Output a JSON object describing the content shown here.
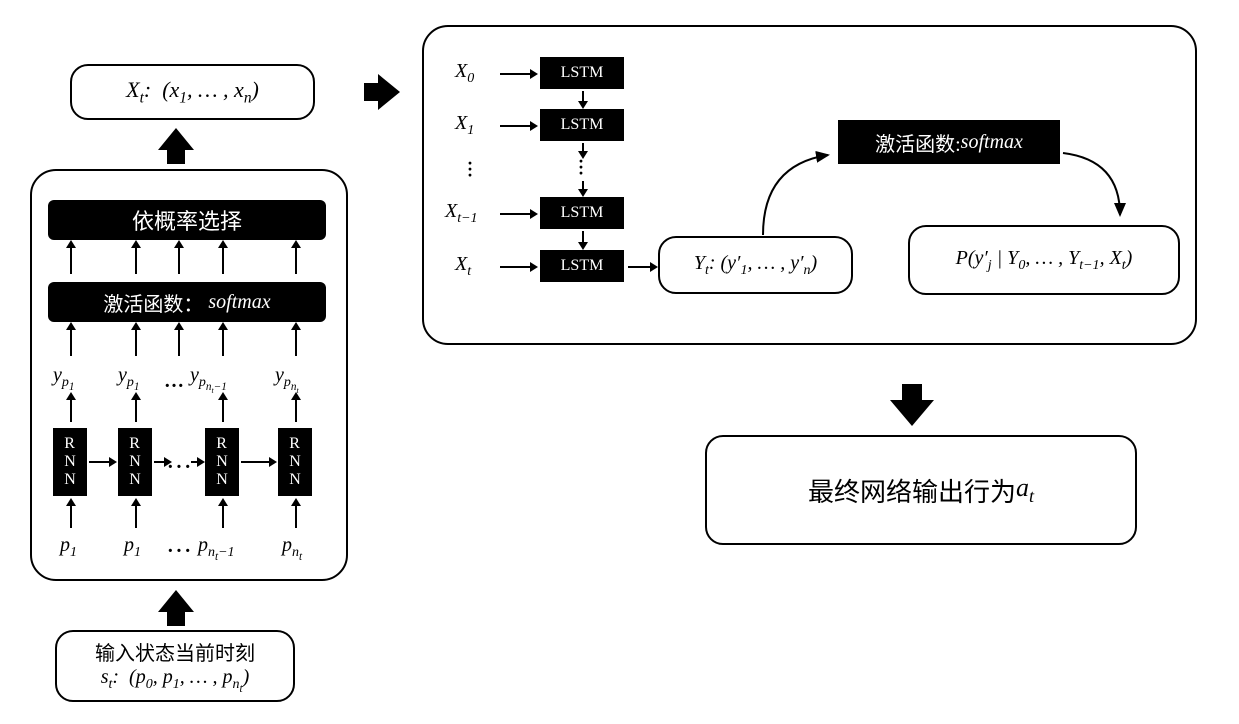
{
  "input_state": {
    "line1": "输入状态当前时刻",
    "line2_prefix": "s",
    "line2_sub": "t",
    "line2_content": ": (p₀, p₁, … , p",
    "line2_sub2": "n_t",
    "line2_close": ")"
  },
  "rnn_block": {
    "selection_label": "依概率选择",
    "activation_label": "激活函数：",
    "activation_fn": "softmax",
    "y_labels": [
      "y_{p_1}",
      "y_{p_1}",
      "…",
      "y_{p_{n_t-1}}",
      "y_{p_{n_t}}"
    ],
    "p_labels": [
      "p_1",
      "p_1",
      "…",
      "p_{n_t-1}",
      "p_{n_t}"
    ],
    "cell": "RNN"
  },
  "xt_output": {
    "prefix": "X",
    "sub": "t",
    "content": ":  (x₁, … , xₙ)"
  },
  "lstm_block": {
    "x_inputs": [
      "X_0",
      "X_1",
      "⋮",
      "X_{t-1}",
      "X_t"
    ],
    "lstm_label": "LSTM",
    "yt_prefix": "Y",
    "yt_sub": "t",
    "yt_content": ": (y′₁, … , y′ₙ)",
    "activation_label": "激活函数:",
    "activation_fn": "softmax",
    "prob_expr": "P(y′_j | Y_0, … , Y_{t-1}, X_t)"
  },
  "final_output": {
    "text": "最终网络输出行为",
    "var": "a",
    "sub": "t"
  }
}
